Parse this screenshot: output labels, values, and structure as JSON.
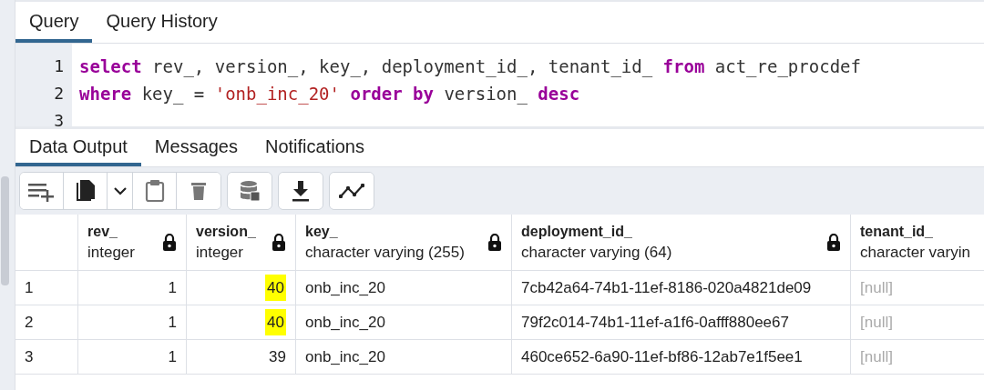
{
  "editor_tabs": [
    {
      "label": "Query",
      "selected": true
    },
    {
      "label": "Query History",
      "selected": false
    }
  ],
  "editor": {
    "lines": [
      {
        "number": "1",
        "tokens": [
          {
            "kind": "keyword",
            "text": "select"
          },
          {
            "kind": "plain",
            "text": " rev_, version_, key_, deployment_id_, tenant_id_ "
          },
          {
            "kind": "keyword",
            "text": "from"
          },
          {
            "kind": "plain",
            "text": " act_re_procdef"
          }
        ]
      },
      {
        "number": "2",
        "tokens": [
          {
            "kind": "keyword",
            "text": "where"
          },
          {
            "kind": "plain",
            "text": " key_ = "
          },
          {
            "kind": "string",
            "text": "'onb_inc_20'"
          },
          {
            "kind": "keyword",
            "text": " order by"
          },
          {
            "kind": "plain",
            "text": " version_ "
          },
          {
            "kind": "keyword",
            "text": "desc"
          }
        ]
      },
      {
        "number": "3"
      }
    ]
  },
  "output_tabs": [
    {
      "label": "Data Output",
      "selected": true
    },
    {
      "label": "Messages",
      "selected": false
    },
    {
      "label": "Notifications",
      "selected": false
    }
  ],
  "table": {
    "columns": [
      {
        "name": "rev_",
        "type": "integer",
        "locked": true
      },
      {
        "name": "version_",
        "type": "integer",
        "locked": true
      },
      {
        "name": "key_",
        "type": "character varying (255)",
        "locked": true
      },
      {
        "name": "deployment_id_",
        "type": "character varying (64)",
        "locked": true
      },
      {
        "name": "tenant_id_",
        "type": "character varyin",
        "locked": false
      }
    ],
    "rows": [
      {
        "number": "1",
        "cells": [
          {
            "text": "1",
            "highlighted": false
          },
          {
            "text": "40",
            "highlighted": true
          },
          {
            "text": "onb_inc_20",
            "highlighted": false
          },
          {
            "text": "7cb42a64-74b1-11ef-8186-020a4821de09",
            "highlighted": false
          },
          {
            "text": "[null]",
            "null": true,
            "highlighted": false
          }
        ]
      },
      {
        "number": "2",
        "cells": [
          {
            "text": "1",
            "highlighted": false
          },
          {
            "text": "40",
            "highlighted": true
          },
          {
            "text": "onb_inc_20",
            "highlighted": false
          },
          {
            "text": "79f2c014-74b1-11ef-a1f6-0afff880ee67",
            "highlighted": false
          },
          {
            "text": "[null]",
            "null": true,
            "highlighted": false
          }
        ]
      },
      {
        "number": "3",
        "cells": [
          {
            "text": "1",
            "highlighted": false
          },
          {
            "text": "39",
            "highlighted": false
          },
          {
            "text": "onb_inc_20",
            "highlighted": false
          },
          {
            "text": "460ce652-6a90-11ef-bf86-12ab7e1f5ee1",
            "highlighted": false
          },
          {
            "text": "[null]",
            "null": true,
            "highlighted": false
          }
        ]
      }
    ]
  }
}
